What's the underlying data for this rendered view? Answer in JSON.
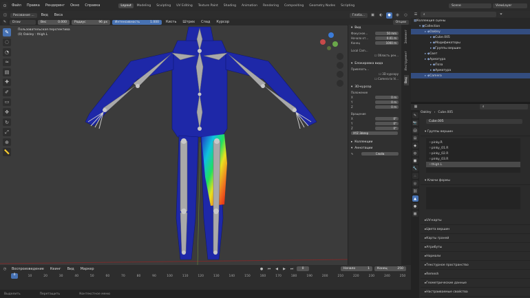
{
  "menubar": {
    "menus": [
      "Файл",
      "Правка",
      "Рендеринг",
      "Окно",
      "Справка"
    ],
    "workspaces": [
      "Layout",
      "Modeling",
      "Sculpting",
      "UV Editing",
      "Texture Paint",
      "Shading",
      "Animation",
      "Rendering",
      "Compositing",
      "Geometry Nodes",
      "Scripting"
    ],
    "active_workspace": "Layout",
    "scene_label": "Scene",
    "view_layer_label": "ViewLayer"
  },
  "viewport_header": {
    "mode": "Рисование ...",
    "view": "Вид",
    "weights": "Веса",
    "weight_label": "Вес",
    "weight_value": "0.000",
    "radius_label": "Радиус",
    "radius_value": "96 px",
    "strength_label": "Интенсивность",
    "strength_value": "1.000",
    "blending": "Смешивание",
    "paint_mode": "Глоба...",
    "brush": "Кисть",
    "stroke": "Штрих",
    "falloff": "Спад",
    "cursor": "Курсор",
    "options": "Опции",
    "draw": "Draw"
  },
  "viewport": {
    "info_line1": "Пользовательская перспектива",
    "info_line2": "(0) Oakley : thigh.L",
    "body_color": "#1e28a8",
    "bone_color": "#a9a9a9"
  },
  "npanel": {
    "section_view": "Вид",
    "focal_label": "Фокусное...",
    "focal_value": "50 mm",
    "clip_start_label": "Начало от...",
    "clip_start_value": "0.01 m",
    "clip_end_label": "Конец",
    "clip_end_value": "1000 m",
    "local_camera": "Local Cam...",
    "render_region": "Область рен...",
    "section_lock": "Блокировка вида",
    "lock_object": "Привязать...",
    "lock_to_cursor": "3D курсору",
    "camera_to_view": "Camera to Vi...",
    "section_cursor": "3D-курсор",
    "location_label": "Положение",
    "loc_x_label": "X",
    "loc_x": "0 m",
    "loc_y_label": "Y",
    "loc_y": "0 m",
    "loc_z_label": "Z",
    "loc_z": "0 m",
    "rotation_label": "Вращение",
    "rot_x_label": "X",
    "rot_x": "0°",
    "rot_y_label": "Y",
    "rot_y": "0°",
    "rot_z_label": "Z",
    "rot_z": "0°",
    "rotation_mode": "XYZ Эйлер",
    "section_collections": "Коллекции",
    "section_annotations": "Аннотации",
    "annotations_action": "Слоёв",
    "tab_item": "Элемент",
    "tab_tool": "Инструмент",
    "tab_view": "Вид"
  },
  "outliner": {
    "search_placeholder": "",
    "rows": [
      {
        "label": "Коллекция сцены",
        "indent": 0,
        "sel": false
      },
      {
        "label": "Collection",
        "indent": 1,
        "sel": false
      },
      {
        "label": "Oakley",
        "indent": 2,
        "sel": true
      },
      {
        "label": "Cube.005",
        "indent": 3,
        "sel": false
      },
      {
        "label": "Модификаторы",
        "indent": 3,
        "sel": false
      },
      {
        "label": "Группы вершин",
        "indent": 3,
        "sel": false
      },
      {
        "label": "Свет",
        "indent": 2,
        "sel": false
      },
      {
        "label": "Арматура",
        "indent": 2,
        "sel": false
      },
      {
        "label": "Поза",
        "indent": 3,
        "sel": false
      },
      {
        "label": "Арматура",
        "indent": 3,
        "sel": false
      },
      {
        "label": "Camera",
        "indent": 2,
        "sel": true
      }
    ]
  },
  "properties": {
    "breadcrumb_object": "Oakley",
    "breadcrumb_mesh": "Cube.005",
    "mesh_name": "Cube.005",
    "vertex_groups_title": "Группы вершин",
    "vertex_groups": [
      "pinky.R",
      "pinky_01.R",
      "pinky_02.R",
      "pinky_03.R",
      "thigh.L"
    ],
    "shape_keys_title": "Ключи формы",
    "sections": [
      "UV-карты",
      "Цвета вершин",
      "Карты граней",
      "Атрибуты",
      "Нормали",
      "Текстурное пространство",
      "Remesh",
      "Геометрические данные",
      "Настраиваемые свойства"
    ]
  },
  "timeline": {
    "playback": "Воспроизведение",
    "keying": "Кеинг",
    "view": "Вид",
    "marker": "Маркер",
    "current_frame": "0",
    "start_label": "Начало",
    "start_value": "1",
    "end_label": "Конец",
    "end_value": "250",
    "ticks": [
      "0",
      "10",
      "20",
      "30",
      "40",
      "50",
      "60",
      "70",
      "80",
      "90",
      "100",
      "110",
      "120",
      "130",
      "140",
      "150",
      "160",
      "170",
      "180",
      "190",
      "200",
      "210",
      "220",
      "230",
      "240",
      "250"
    ],
    "status": [
      "Выделить",
      "Перетащить",
      "Контекстное меню"
    ]
  }
}
